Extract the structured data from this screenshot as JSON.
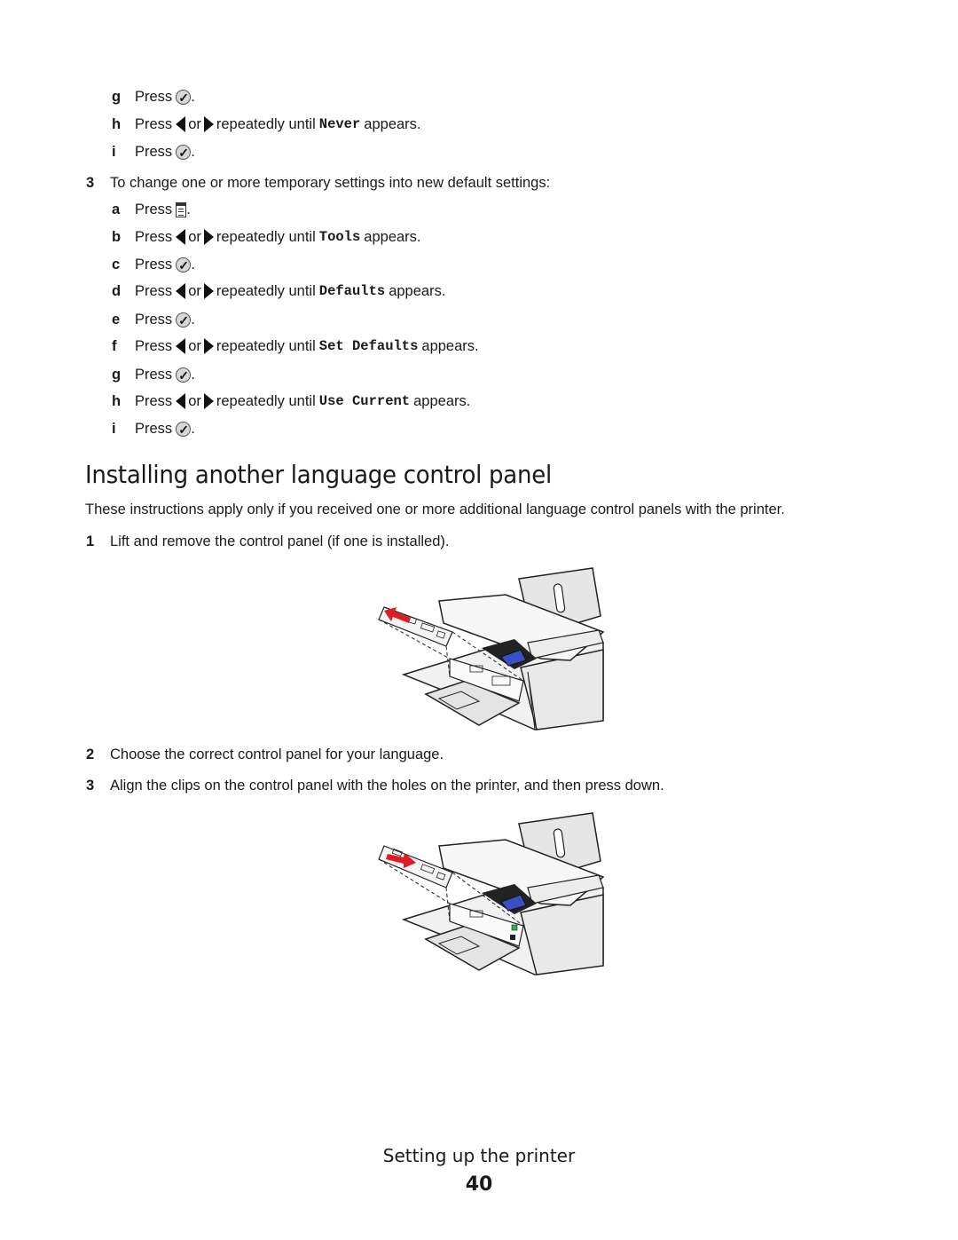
{
  "steps_top": [
    {
      "marker": "g",
      "type": "check",
      "press": "Press",
      "end": "."
    },
    {
      "marker": "h",
      "type": "arrows",
      "press": "Press",
      "or": "or",
      "until": "repeatedly until",
      "value": "Never",
      "appears": "appears."
    },
    {
      "marker": "i",
      "type": "check",
      "press": "Press",
      "end": "."
    }
  ],
  "step3": {
    "number": "3",
    "text": "To change one or more temporary settings into new default settings:",
    "substeps": [
      {
        "marker": "a",
        "type": "menu",
        "press": "Press",
        "end": "."
      },
      {
        "marker": "b",
        "type": "arrows",
        "press": "Press",
        "or": "or",
        "until": "repeatedly until",
        "value": "Tools",
        "appears": "appears."
      },
      {
        "marker": "c",
        "type": "check",
        "press": "Press",
        "end": "."
      },
      {
        "marker": "d",
        "type": "arrows",
        "press": "Press",
        "or": "or",
        "until": "repeatedly until",
        "value": "Defaults",
        "appears": "appears."
      },
      {
        "marker": "e",
        "type": "check",
        "press": "Press",
        "end": "."
      },
      {
        "marker": "f",
        "type": "arrows",
        "press": "Press",
        "or": "or",
        "until": "repeatedly until",
        "value": "Set Defaults",
        "appears": "appears."
      },
      {
        "marker": "g",
        "type": "check",
        "press": "Press",
        "end": "."
      },
      {
        "marker": "h",
        "type": "arrows",
        "press": "Press",
        "or": "or",
        "until": "repeatedly until",
        "value": "Use Current",
        "appears": "appears."
      },
      {
        "marker": "i",
        "type": "check",
        "press": "Press",
        "end": "."
      }
    ]
  },
  "section": {
    "heading": "Installing another language control panel",
    "intro": "These instructions apply only if you received one or more additional language control panels with the printer.",
    "steps": [
      {
        "number": "1",
        "text": "Lift and remove the control panel (if one is installed)."
      },
      {
        "number": "2",
        "text": "Choose the correct control panel for your language."
      },
      {
        "number": "3",
        "text": "Align the clips on the control panel with the holes on the printer, and then press down."
      }
    ],
    "figures": [
      {
        "name": "printer-remove-panel-illustration",
        "arrow_direction": "out",
        "arrow_color": "#e01b24"
      },
      {
        "name": "printer-install-panel-illustration",
        "arrow_direction": "in",
        "arrow_color": "#e01b24"
      }
    ]
  },
  "footer": {
    "section_title": "Setting up the printer",
    "page_number": "40"
  },
  "colors": {
    "text": "#1a1a1a",
    "arrow_red": "#e01b24",
    "cartridge_blue": "#3a4fc4",
    "button_green": "#2fb34a"
  }
}
